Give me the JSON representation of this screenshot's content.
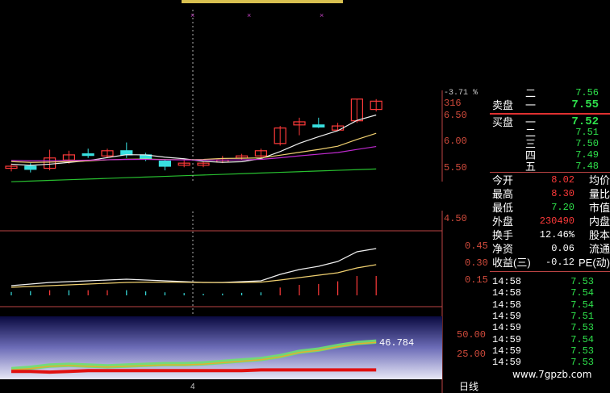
{
  "chart_data": {
    "type": "candlestick",
    "price_axis": {
      "ticks": [
        "6.50",
        "6.00",
        "5.50",
        "4.50"
      ],
      "small_top": "-3.71 %",
      "count_label": "316"
    },
    "candles": [
      {
        "o": 5.46,
        "c": 5.5,
        "h": 5.55,
        "l": 5.4
      },
      {
        "o": 5.5,
        "c": 5.44,
        "h": 5.56,
        "l": 5.38
      },
      {
        "o": 5.46,
        "c": 5.66,
        "h": 5.82,
        "l": 5.42
      },
      {
        "o": 5.62,
        "c": 5.72,
        "h": 5.8,
        "l": 5.55
      },
      {
        "o": 5.74,
        "c": 5.72,
        "h": 5.84,
        "l": 5.66
      },
      {
        "o": 5.7,
        "c": 5.8,
        "h": 5.84,
        "l": 5.66
      },
      {
        "o": 5.8,
        "c": 5.72,
        "h": 5.96,
        "l": 5.66
      },
      {
        "o": 5.72,
        "c": 5.64,
        "h": 5.76,
        "l": 5.6
      },
      {
        "o": 5.6,
        "c": 5.5,
        "h": 5.62,
        "l": 5.42
      },
      {
        "o": 5.52,
        "c": 5.56,
        "h": 5.62,
        "l": 5.48
      },
      {
        "o": 5.52,
        "c": 5.56,
        "h": 5.6,
        "l": 5.48
      },
      {
        "o": 5.58,
        "c": 5.62,
        "h": 5.7,
        "l": 5.56
      },
      {
        "o": 5.66,
        "c": 5.7,
        "h": 5.74,
        "l": 5.62
      },
      {
        "o": 5.7,
        "c": 5.8,
        "h": 5.84,
        "l": 5.66
      },
      {
        "o": 5.94,
        "c": 6.24,
        "h": 6.28,
        "l": 5.9
      },
      {
        "o": 6.3,
        "c": 6.36,
        "h": 6.44,
        "l": 6.1
      },
      {
        "o": 6.3,
        "c": 6.26,
        "h": 6.44,
        "l": 6.24
      },
      {
        "o": 6.2,
        "c": 6.28,
        "h": 6.34,
        "l": 6.18
      },
      {
        "o": 6.38,
        "c": 6.8,
        "h": 6.8,
        "l": 6.34
      },
      {
        "o": 6.6,
        "c": 6.76,
        "h": 6.8,
        "l": 6.56
      }
    ],
    "indicator": {
      "ticks": [
        "0.45",
        "0.30",
        "0.15"
      ]
    },
    "oscillator": {
      "ticks": [
        "50.00",
        "25.00"
      ],
      "value_label": "46.784"
    }
  },
  "quotes": {
    "sell": [
      {
        "name": "二",
        "price": "7.56"
      },
      {
        "name": "一",
        "price": "7.55"
      }
    ],
    "sell_label": "卖盘",
    "buy_label": "买盘",
    "buy": [
      {
        "name": "一",
        "price": "7.52"
      },
      {
        "name": "二",
        "price": "7.51"
      },
      {
        "name": "三",
        "price": "7.50"
      },
      {
        "name": "四",
        "price": "7.49"
      },
      {
        "name": "五",
        "price": "7.48"
      }
    ]
  },
  "stats": [
    {
      "a": "今开",
      "v": "8.02",
      "vc": "#ff3a3a",
      "b": "均价"
    },
    {
      "a": "最高",
      "v": "8.30",
      "vc": "#ff3a3a",
      "b": "量比"
    },
    {
      "a": "最低",
      "v": "7.20",
      "vc": "#2ee04b",
      "b": "市值"
    },
    {
      "a": "外盘",
      "v": "230490",
      "vc": "#ff3a3a",
      "b": "内盘"
    },
    {
      "a": "换手",
      "v": "12.46%",
      "vc": "#ffffff",
      "b": "股本"
    },
    {
      "a": "净资",
      "v": "0.06",
      "vc": "#ffffff",
      "b": "流通"
    },
    {
      "a": "收益(三)",
      "v": "-0.12",
      "vc": "#ffffff",
      "b": "PE(动)"
    }
  ],
  "ticks": [
    {
      "t": "14:58",
      "p": "7.53"
    },
    {
      "t": "14:58",
      "p": "7.54"
    },
    {
      "t": "14:58",
      "p": "7.54"
    },
    {
      "t": "14:59",
      "p": "7.51"
    },
    {
      "t": "14:59",
      "p": "7.53"
    },
    {
      "t": "14:59",
      "p": "7.54"
    },
    {
      "t": "14:59",
      "p": "7.53"
    },
    {
      "t": "14:59",
      "p": "7.53"
    }
  ],
  "bottom": {
    "period_label": "日线",
    "cursor_label": "4"
  },
  "watermark": "www.7gpzb.com",
  "colors": {
    "up": "#ff3a3a",
    "down": "#38e0e0",
    "ma5": "#f0f0f0",
    "ma10": "#f0d070",
    "ma20": "#c02ad0",
    "ma60": "#28c030"
  }
}
